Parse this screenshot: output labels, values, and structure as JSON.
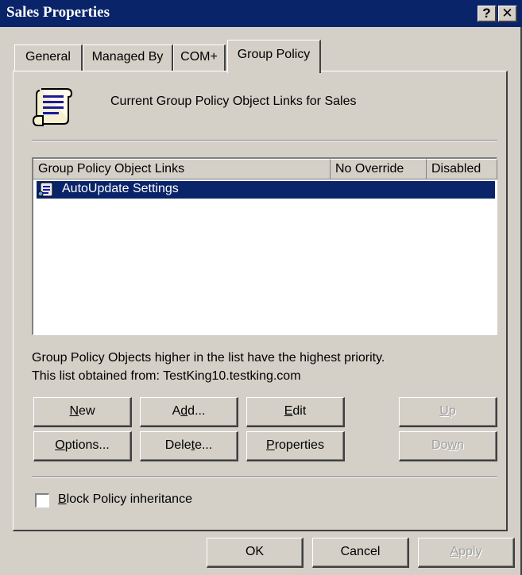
{
  "window": {
    "title": "Sales Properties",
    "help_glyph": "?",
    "close_glyph": "✕"
  },
  "tabs": [
    {
      "label": "General"
    },
    {
      "label": "Managed By"
    },
    {
      "label": "COM+"
    },
    {
      "label": "Group Policy",
      "selected": true
    }
  ],
  "header": {
    "icon": "group-policy-scroll-icon",
    "text": "Current Group Policy Object Links for Sales"
  },
  "list": {
    "columns": [
      "Group Policy Object Links",
      "No Override",
      "Disabled"
    ],
    "rows": [
      {
        "icon": "gpo-icon",
        "name": "AutoUpdate Settings",
        "no_override": "",
        "disabled": "",
        "selected": true
      }
    ]
  },
  "info": {
    "priority_note": "Group Policy Objects higher in the list have the highest priority.",
    "source": "This list obtained from: TestKing10.testking.com"
  },
  "buttons": {
    "new": {
      "pre": "",
      "key": "N",
      "post": "ew"
    },
    "add": {
      "pre": "A",
      "key": "d",
      "post": "d..."
    },
    "edit": {
      "pre": "",
      "key": "E",
      "post": "dit"
    },
    "up": {
      "pre": "",
      "key": "U",
      "post": "p"
    },
    "options": {
      "pre": "",
      "key": "O",
      "post": "ptions..."
    },
    "delete": {
      "pre": "Dele",
      "key": "t",
      "post": "e..."
    },
    "properties": {
      "pre": "",
      "key": "P",
      "post": "roperties"
    },
    "down": {
      "pre": "Do",
      "key": "w",
      "post": "n"
    }
  },
  "block_inheritance": {
    "label_pre": "",
    "label_key": "B",
    "label_post": "lock Policy inheritance",
    "checked": false
  },
  "footer": {
    "ok": "OK",
    "cancel": "Cancel",
    "apply": {
      "pre": "",
      "key": "A",
      "post": "pply"
    }
  },
  "colors": {
    "title_bar": "#0a246a",
    "face": "#d4d0c8",
    "selection": "#0a246a"
  }
}
